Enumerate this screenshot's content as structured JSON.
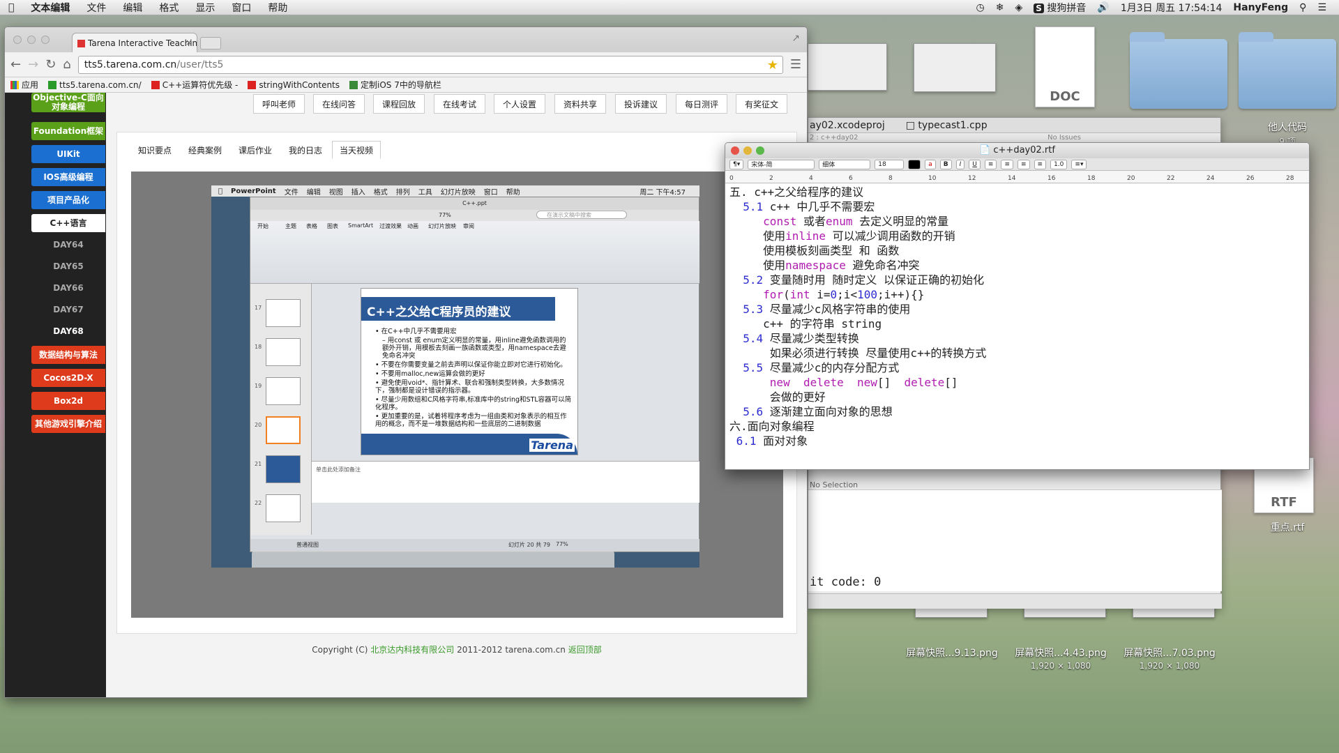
{
  "menubar": {
    "app": "文本编辑",
    "items": [
      "文件",
      "编辑",
      "格式",
      "显示",
      "窗口",
      "帮助"
    ],
    "input_method": "搜狗拼音",
    "datetime": "1月3日 周五  17:54:14",
    "user": "HanyFeng"
  },
  "desktop": {
    "doc_label": "DOC",
    "folder_label": "他人代码",
    "folder_sub": "9 项",
    "rtf_label": "RTF",
    "rtf_file": "重点.rtf",
    "screenshots": [
      {
        "name": "屏幕快照...9.13.png",
        "size": ""
      },
      {
        "name": "屏幕快照...4.43.png",
        "size": "1,920 × 1,080"
      },
      {
        "name": "屏幕快照...7.03.png",
        "size": "1,920 × 1,080"
      }
    ]
  },
  "xcode": {
    "tab1": "ay02.xcodeproj",
    "tab2": "typecast1.cpp",
    "crumb": "2 : c++day02",
    "issues": "No Issues",
    "selection": "No Selection",
    "exit": "it code: 0"
  },
  "browser": {
    "tab_title": "Tarena Interactive Teachin",
    "url_host": "tts5.tarena.com.cn",
    "url_path": "/user/tts5",
    "bookmarks": [
      "应用",
      "tts5.tarena.com.cn/",
      "C++运算符优先级 - ",
      "stringWithContents",
      "定制iOS 7中的导航栏"
    ]
  },
  "sidebar": {
    "items": [
      {
        "label": "Objective-C面向对象编程",
        "style": "g"
      },
      {
        "label": "Foundation框架",
        "style": "g"
      },
      {
        "label": "UIKit",
        "style": "b"
      },
      {
        "label": "IOS高级编程",
        "style": "b"
      },
      {
        "label": "项目产品化",
        "style": "b"
      },
      {
        "label": "C++语言",
        "style": "w"
      },
      {
        "label": "DAY64",
        "style": "d"
      },
      {
        "label": "DAY65",
        "style": "d"
      },
      {
        "label": "DAY66",
        "style": "d"
      },
      {
        "label": "DAY67",
        "style": "d"
      },
      {
        "label": "DAY68",
        "style": "a"
      },
      {
        "label": "数据结构与算法",
        "style": "r"
      },
      {
        "label": "Cocos2D-X",
        "style": "r"
      },
      {
        "label": "Box2d",
        "style": "r"
      },
      {
        "label": "其他游戏引擎介绍",
        "style": "r"
      }
    ]
  },
  "topnav": [
    "呼叫老师",
    "在线问答",
    "课程回放",
    "在线考试",
    "个人设置",
    "资料共享",
    "投诉建议",
    "每日测评",
    "有奖征文"
  ],
  "panel_tabs": [
    "知识要点",
    "经典案例",
    "课后作业",
    "我的日志",
    "当天视频"
  ],
  "video": {
    "menu": [
      "PowerPoint",
      "文件",
      "编辑",
      "视图",
      "插入",
      "格式",
      "排列",
      "工具",
      "幻灯片放映",
      "窗口",
      "帮助"
    ],
    "clock": "周二 下午4:57",
    "doc": "C++.ppt",
    "search": "在演示文稿中搜索",
    "zoom": "77%",
    "ribbon_tabs": [
      "开始",
      "主题",
      "表格",
      "图表",
      "SmartArt",
      "过渡效果",
      "动画",
      "幻灯片放映",
      "审阅"
    ],
    "thumb_nums": [
      "17",
      "18",
      "19",
      "20",
      "21",
      "22"
    ],
    "slide_title": "C++之父给C程序员的建议",
    "slide_lines": [
      "•  在C++中几乎不需要用宏",
      "    –  用const 或 enum定义明显的常量，用inline避免函数调用的额外开销，用模板去刻画一族函数或类型，用namespace去避免命名冲突",
      "•  不要在你需要变量之前去声明以保证你能立即对它进行初始化。",
      "•  不要用malloc,new运算会做的更好",
      "•  避免使用void*、指针算术、联合和强制类型转换，大多数情况下，强制都是设计错误的指示器。",
      "•  尽量少用数组和C风格字符串,标准库中的string和STL容器可以简化程序。",
      "•  更加重要的是，试着将程序考虑为一组由类和对象表示的相互作用的概念，而不是一堆数据结构和一些底层的二进制数据"
    ],
    "slide_logo": "Tarena",
    "notes": "单击此处添加备注",
    "status_left": "普通视图",
    "status_mid": "幻灯片 20 共 79",
    "status_zoom": "77%"
  },
  "footer": {
    "copyright": "Copyright (C)",
    "company": "北京达内科技有限公司",
    "years": "2011-2012 tarena.com.cn",
    "back": "返回顶部"
  },
  "textedit": {
    "title": "c++day02.rtf",
    "font": "宋体-简",
    "style": "细体",
    "size": "18",
    "spacing": "1.0",
    "ruler": [
      "0",
      "2",
      "4",
      "6",
      "8",
      "10",
      "12",
      "14",
      "16",
      "18",
      "20",
      "22",
      "24",
      "26",
      "28"
    ]
  }
}
